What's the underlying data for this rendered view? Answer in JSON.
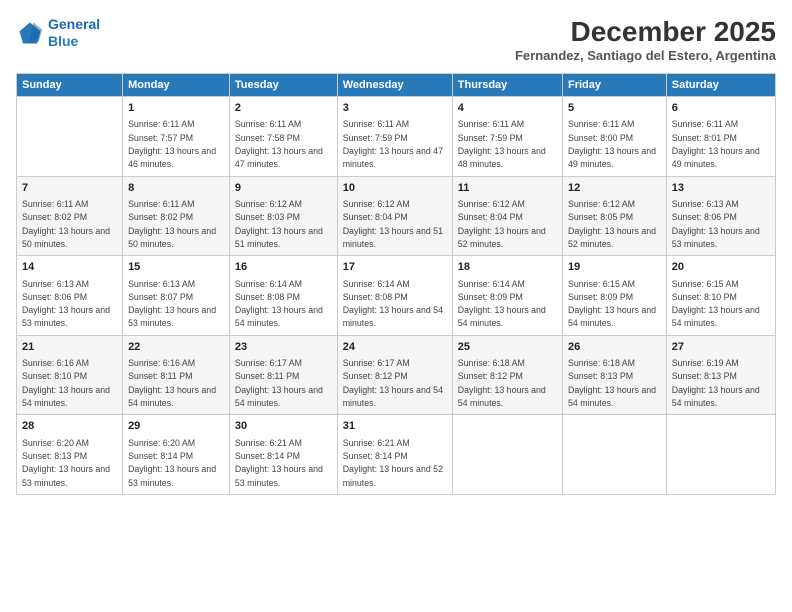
{
  "logo": {
    "line1": "General",
    "line2": "Blue"
  },
  "title": "December 2025",
  "subtitle": "Fernandez, Santiago del Estero, Argentina",
  "days_header": [
    "Sunday",
    "Monday",
    "Tuesday",
    "Wednesday",
    "Thursday",
    "Friday",
    "Saturday"
  ],
  "weeks": [
    [
      {
        "day": "",
        "sunrise": "",
        "sunset": "",
        "daylight": ""
      },
      {
        "day": "1",
        "sunrise": "Sunrise: 6:11 AM",
        "sunset": "Sunset: 7:57 PM",
        "daylight": "Daylight: 13 hours and 46 minutes."
      },
      {
        "day": "2",
        "sunrise": "Sunrise: 6:11 AM",
        "sunset": "Sunset: 7:58 PM",
        "daylight": "Daylight: 13 hours and 47 minutes."
      },
      {
        "day": "3",
        "sunrise": "Sunrise: 6:11 AM",
        "sunset": "Sunset: 7:59 PM",
        "daylight": "Daylight: 13 hours and 47 minutes."
      },
      {
        "day": "4",
        "sunrise": "Sunrise: 6:11 AM",
        "sunset": "Sunset: 7:59 PM",
        "daylight": "Daylight: 13 hours and 48 minutes."
      },
      {
        "day": "5",
        "sunrise": "Sunrise: 6:11 AM",
        "sunset": "Sunset: 8:00 PM",
        "daylight": "Daylight: 13 hours and 49 minutes."
      },
      {
        "day": "6",
        "sunrise": "Sunrise: 6:11 AM",
        "sunset": "Sunset: 8:01 PM",
        "daylight": "Daylight: 13 hours and 49 minutes."
      }
    ],
    [
      {
        "day": "7",
        "sunrise": "Sunrise: 6:11 AM",
        "sunset": "Sunset: 8:02 PM",
        "daylight": "Daylight: 13 hours and 50 minutes."
      },
      {
        "day": "8",
        "sunrise": "Sunrise: 6:11 AM",
        "sunset": "Sunset: 8:02 PM",
        "daylight": "Daylight: 13 hours and 50 minutes."
      },
      {
        "day": "9",
        "sunrise": "Sunrise: 6:12 AM",
        "sunset": "Sunset: 8:03 PM",
        "daylight": "Daylight: 13 hours and 51 minutes."
      },
      {
        "day": "10",
        "sunrise": "Sunrise: 6:12 AM",
        "sunset": "Sunset: 8:04 PM",
        "daylight": "Daylight: 13 hours and 51 minutes."
      },
      {
        "day": "11",
        "sunrise": "Sunrise: 6:12 AM",
        "sunset": "Sunset: 8:04 PM",
        "daylight": "Daylight: 13 hours and 52 minutes."
      },
      {
        "day": "12",
        "sunrise": "Sunrise: 6:12 AM",
        "sunset": "Sunset: 8:05 PM",
        "daylight": "Daylight: 13 hours and 52 minutes."
      },
      {
        "day": "13",
        "sunrise": "Sunrise: 6:13 AM",
        "sunset": "Sunset: 8:06 PM",
        "daylight": "Daylight: 13 hours and 53 minutes."
      }
    ],
    [
      {
        "day": "14",
        "sunrise": "Sunrise: 6:13 AM",
        "sunset": "Sunset: 8:06 PM",
        "daylight": "Daylight: 13 hours and 53 minutes."
      },
      {
        "day": "15",
        "sunrise": "Sunrise: 6:13 AM",
        "sunset": "Sunset: 8:07 PM",
        "daylight": "Daylight: 13 hours and 53 minutes."
      },
      {
        "day": "16",
        "sunrise": "Sunrise: 6:14 AM",
        "sunset": "Sunset: 8:08 PM",
        "daylight": "Daylight: 13 hours and 54 minutes."
      },
      {
        "day": "17",
        "sunrise": "Sunrise: 6:14 AM",
        "sunset": "Sunset: 8:08 PM",
        "daylight": "Daylight: 13 hours and 54 minutes."
      },
      {
        "day": "18",
        "sunrise": "Sunrise: 6:14 AM",
        "sunset": "Sunset: 8:09 PM",
        "daylight": "Daylight: 13 hours and 54 minutes."
      },
      {
        "day": "19",
        "sunrise": "Sunrise: 6:15 AM",
        "sunset": "Sunset: 8:09 PM",
        "daylight": "Daylight: 13 hours and 54 minutes."
      },
      {
        "day": "20",
        "sunrise": "Sunrise: 6:15 AM",
        "sunset": "Sunset: 8:10 PM",
        "daylight": "Daylight: 13 hours and 54 minutes."
      }
    ],
    [
      {
        "day": "21",
        "sunrise": "Sunrise: 6:16 AM",
        "sunset": "Sunset: 8:10 PM",
        "daylight": "Daylight: 13 hours and 54 minutes."
      },
      {
        "day": "22",
        "sunrise": "Sunrise: 6:16 AM",
        "sunset": "Sunset: 8:11 PM",
        "daylight": "Daylight: 13 hours and 54 minutes."
      },
      {
        "day": "23",
        "sunrise": "Sunrise: 6:17 AM",
        "sunset": "Sunset: 8:11 PM",
        "daylight": "Daylight: 13 hours and 54 minutes."
      },
      {
        "day": "24",
        "sunrise": "Sunrise: 6:17 AM",
        "sunset": "Sunset: 8:12 PM",
        "daylight": "Daylight: 13 hours and 54 minutes."
      },
      {
        "day": "25",
        "sunrise": "Sunrise: 6:18 AM",
        "sunset": "Sunset: 8:12 PM",
        "daylight": "Daylight: 13 hours and 54 minutes."
      },
      {
        "day": "26",
        "sunrise": "Sunrise: 6:18 AM",
        "sunset": "Sunset: 8:13 PM",
        "daylight": "Daylight: 13 hours and 54 minutes."
      },
      {
        "day": "27",
        "sunrise": "Sunrise: 6:19 AM",
        "sunset": "Sunset: 8:13 PM",
        "daylight": "Daylight: 13 hours and 54 minutes."
      }
    ],
    [
      {
        "day": "28",
        "sunrise": "Sunrise: 6:20 AM",
        "sunset": "Sunset: 8:13 PM",
        "daylight": "Daylight: 13 hours and 53 minutes."
      },
      {
        "day": "29",
        "sunrise": "Sunrise: 6:20 AM",
        "sunset": "Sunset: 8:14 PM",
        "daylight": "Daylight: 13 hours and 53 minutes."
      },
      {
        "day": "30",
        "sunrise": "Sunrise: 6:21 AM",
        "sunset": "Sunset: 8:14 PM",
        "daylight": "Daylight: 13 hours and 53 minutes."
      },
      {
        "day": "31",
        "sunrise": "Sunrise: 6:21 AM",
        "sunset": "Sunset: 8:14 PM",
        "daylight": "Daylight: 13 hours and 52 minutes."
      },
      {
        "day": "",
        "sunrise": "",
        "sunset": "",
        "daylight": ""
      },
      {
        "day": "",
        "sunrise": "",
        "sunset": "",
        "daylight": ""
      },
      {
        "day": "",
        "sunrise": "",
        "sunset": "",
        "daylight": ""
      }
    ]
  ]
}
